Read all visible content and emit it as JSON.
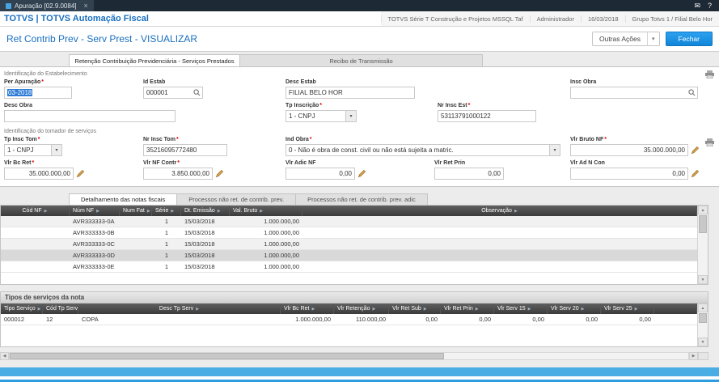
{
  "icons": {
    "mail": "✉",
    "help": "?",
    "chevron_down": "▾",
    "sort_arrow": "▶",
    "scroll_up": "▲",
    "scroll_down": "▼",
    "scroll_left": "◀",
    "scroll_right": "▶"
  },
  "misc": {
    "required": "*"
  },
  "window": {
    "tab_title": "Apuração [02.9.0084]",
    "close": "×"
  },
  "header": {
    "brand": "TOTVS | TOTVS Automação Fiscal",
    "env": "TOTVS Série T Construção e Projetos MSSQL Taf",
    "user": "Administrador",
    "date": "16/03/2018",
    "branch": "Grupo Totvs 1 / Filial Belo Hor"
  },
  "toolbar": {
    "title": "Ret Contrib Prev - Serv Prest - VISUALIZAR",
    "other_actions": "Outras Ações",
    "close": "Fechar"
  },
  "main_tabs": {
    "retencao": "Retenção Contribuição Previdenciária - Serviços Prestados",
    "recibo": "Recibo de Transmissão"
  },
  "estab": {
    "section_title": "Identificação do Estabelecimento",
    "per_apuracao_label": "Per Apuração",
    "per_apuracao_value": "03-2018",
    "id_estab_label": "Id Estab",
    "id_estab_value": "000001",
    "desc_estab_label": "Desc Estab",
    "desc_estab_value": "FILIAL BELO HOR",
    "insc_obra_label": "Insc Obra",
    "insc_obra_value": "",
    "desc_obra_label": "Desc Obra",
    "desc_obra_value": "",
    "tp_inscricao_label": "Tp Inscrição",
    "tp_inscricao_value": "1 - CNPJ",
    "nr_insc_est_label": "Nr Insc Est",
    "nr_insc_est_value": "53113791000122"
  },
  "tomador": {
    "section_title": "Identificação do tomador de serviços",
    "tp_insc_tom_label": "Tp Insc Tom",
    "tp_insc_tom_value": "1 - CNPJ",
    "nr_insc_tom_label": "Nr Insc Tom",
    "nr_insc_tom_value": "35216095772480",
    "ind_obra_label": "Ind Obra",
    "ind_obra_value": "0 - Não é obra de const. civil ou não está sujeita a matric.",
    "vlr_bruto_nf_label": "Vlr Bruto NF",
    "vlr_bruto_nf_value": "35.000.000,00",
    "vlr_bc_ret_label": "Vlr Bc Ret",
    "vlr_bc_ret_value": "35.000.000,00",
    "vlr_nf_contr_label": "Vlr NF Contr",
    "vlr_nf_contr_value": "3.850.000,00",
    "vlr_adic_nf_label": "Vlr Adic NF",
    "vlr_adic_nf_value": "0,00",
    "vlr_ret_prin_label": "Vlr Ret Prin",
    "vlr_ret_prin_value": "0,00",
    "vlr_ad_n_con_label": "Vlr Ad N Con",
    "vlr_ad_n_con_value": "0,00"
  },
  "detail_tabs": {
    "notas": "Detalhamento das notas fiscais",
    "processos": "Processos não ret. de contrib. prev.",
    "processos_adic": "Processos não ret. de contrib. prev. adic"
  },
  "nf_table": {
    "headers": [
      "Cód NF",
      "Núm NF",
      "Num Fat",
      "Série",
      "Dt. Emissão",
      "Val. Bruto",
      "Observação"
    ],
    "rows": [
      {
        "cod_nf": "",
        "num_nf": "AVR333333-0A",
        "num_fat": "",
        "serie": "1",
        "dt_emissao": "15/03/2018",
        "val_bruto": "1.000.000,00",
        "observacao": ""
      },
      {
        "cod_nf": "",
        "num_nf": "AVR333333-0B",
        "num_fat": "",
        "serie": "1",
        "dt_emissao": "15/03/2018",
        "val_bruto": "1.000.000,00",
        "observacao": ""
      },
      {
        "cod_nf": "",
        "num_nf": "AVR333333-0C",
        "num_fat": "",
        "serie": "1",
        "dt_emissao": "15/03/2018",
        "val_bruto": "1.000.000,00",
        "observacao": ""
      },
      {
        "cod_nf": "",
        "num_nf": "AVR333333-0D",
        "num_fat": "",
        "serie": "1",
        "dt_emissao": "15/03/2018",
        "val_bruto": "1.000.000,00",
        "observacao": ""
      },
      {
        "cod_nf": "",
        "num_nf": "AVR333333-0E",
        "num_fat": "",
        "serie": "1",
        "dt_emissao": "15/03/2018",
        "val_bruto": "1.000.000,00",
        "observacao": ""
      }
    ]
  },
  "servicos": {
    "title": "Tipos de serviços da nota",
    "headers": [
      "Tipo Serviço",
      "Cód Tp Serv",
      "Desc Tp Serv",
      "Vlr Bc Ret",
      "Vlr Retenção",
      "Vlr Ret Sub",
      "Vlr Ret Prin",
      "Vlr Serv 15",
      "Vlr Serv 20",
      "Vlr Serv 25"
    ],
    "rows": [
      {
        "tipo_servico": "000012",
        "cod_tp_serv": "12",
        "desc_tp_serv": "COPA",
        "vlr_bc_ret": "1.000.000,00",
        "vlr_retencao": "110.000,00",
        "vlr_ret_sub": "0,00",
        "vlr_ret_prin": "0,00",
        "vlr_serv_15": "0,00",
        "vlr_serv_20": "0,00",
        "vlr_serv_25": "0,00"
      }
    ]
  }
}
